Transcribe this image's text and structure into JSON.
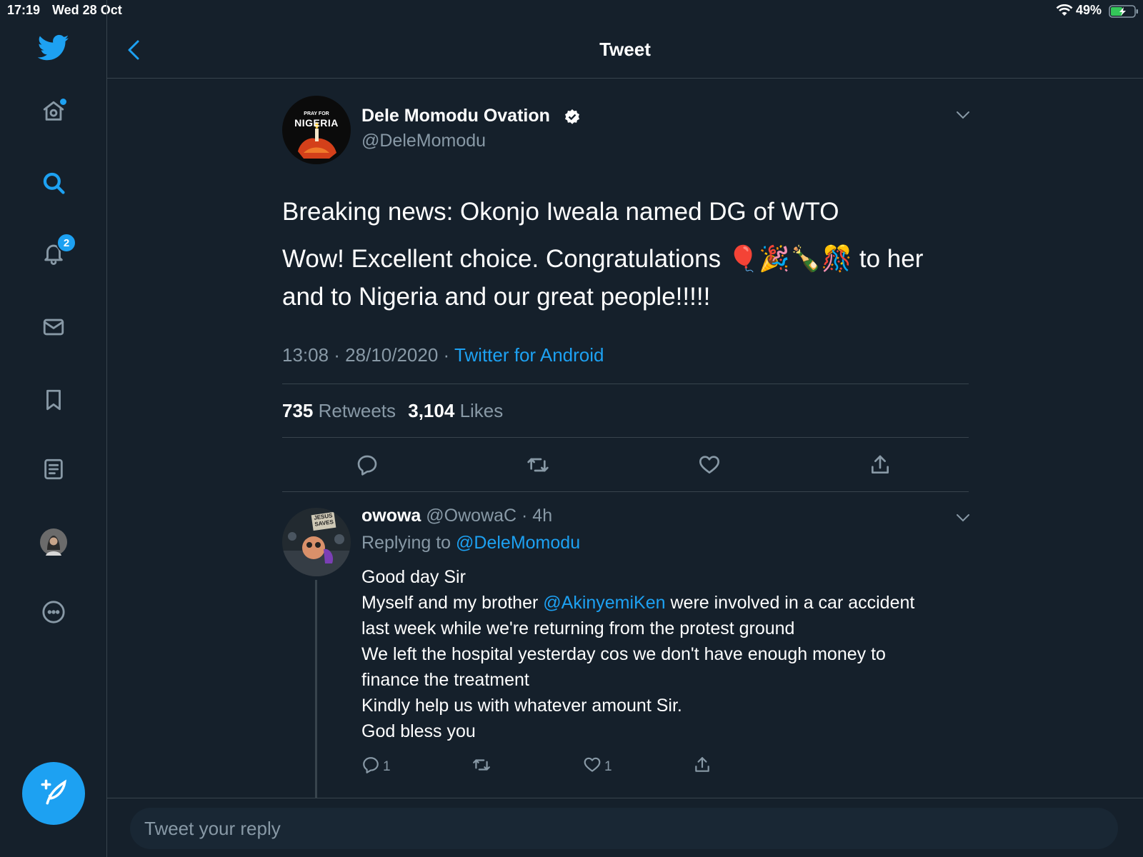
{
  "status_bar": {
    "time": "17:19",
    "date": "Wed 28 Oct",
    "battery": "49%"
  },
  "sidebar": {
    "items": [
      {
        "icon": "home-icon",
        "dot": true
      },
      {
        "icon": "search-icon",
        "active": true
      },
      {
        "icon": "bell-icon",
        "badge": "2"
      },
      {
        "icon": "mail-icon"
      },
      {
        "icon": "bookmark-icon"
      },
      {
        "icon": "lists-icon"
      },
      {
        "icon": "profile-avatar"
      },
      {
        "icon": "more-icon"
      }
    ],
    "compose_icon": "compose-feather-icon"
  },
  "header": {
    "title": "Tweet",
    "back_icon": "back-chevron-icon"
  },
  "tweet": {
    "avatar_text_top": "PRAY FOR",
    "avatar_text_main": "NIGERIA",
    "display_name": "Dele Momodu Ovation",
    "handle": "@DeleMomodu",
    "verified": true,
    "line1": "Breaking news: Okonjo Iweala named DG of WTO",
    "line2a": "Wow! Excellent choice. Congratulations 🎈🎉🍾🎊 to her",
    "line2b": "and to Nigeria and our great people!!!!!",
    "timestamp": "13:08 · 28/10/2020 · ",
    "source": "Twitter for Android",
    "retweets_count": "735",
    "retweets_label": "Retweets",
    "likes_count": "3,104",
    "likes_label": "Likes"
  },
  "reply": {
    "avatar_sign": "JESUS SAVES",
    "name": "owowa",
    "handle_time": "@OwowaC · 4h",
    "replying_label": "Replying to",
    "replying_to": "@DeleMomodu",
    "line1": "Good day Sir",
    "line2a": "Myself and my brother ",
    "mention": "@AkinyemiKen",
    "line2b": " were involved in a car accident",
    "line3": "last week while we're returning from the protest ground",
    "line4": "We left the hospital yesterday cos we don't have enough money to",
    "line5": "finance the treatment",
    "line6": "Kindly help us with whatever amount Sir.",
    "line7": "God bless you",
    "reply_count": "1",
    "like_count": "1"
  },
  "reply_box": {
    "placeholder": "Tweet your reply"
  },
  "colors": {
    "background": "#15202b",
    "accent": "#1da1f2",
    "muted": "#8899a6",
    "border": "#38444d"
  }
}
